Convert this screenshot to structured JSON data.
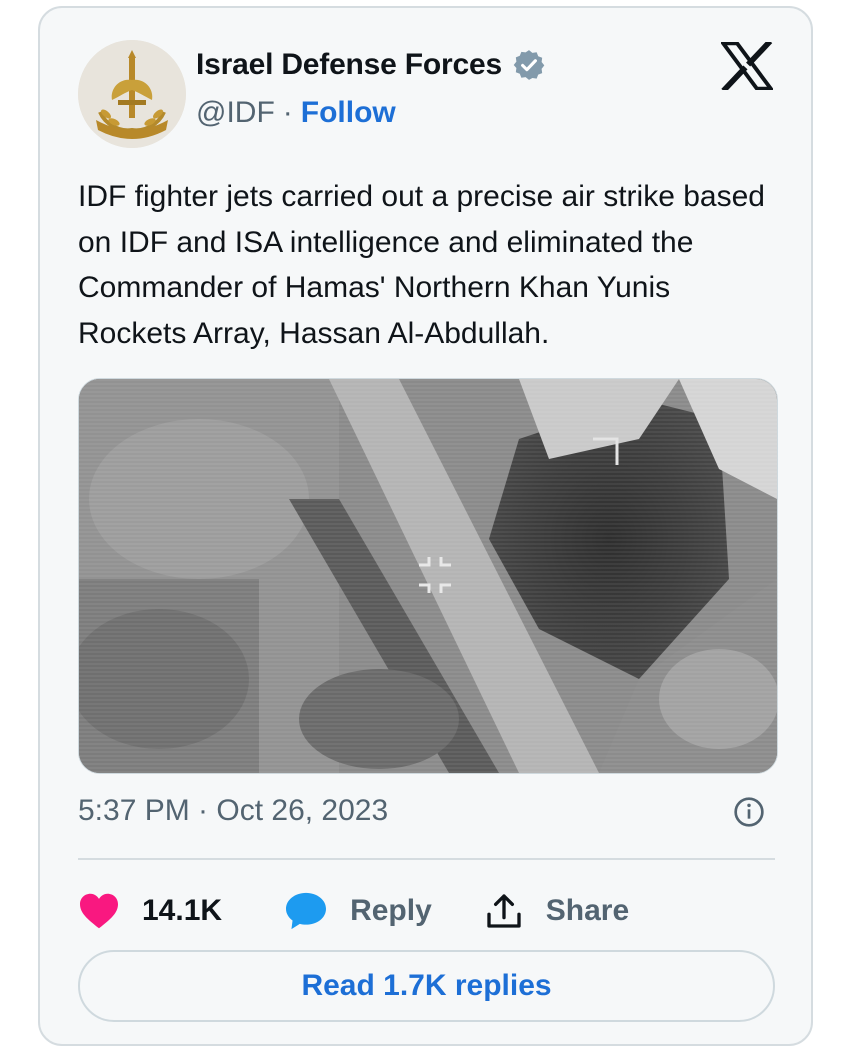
{
  "author": {
    "display_name": "Israel Defense Forces",
    "handle": "@IDF",
    "separator": "·",
    "follow_label": "Follow",
    "avatar_icon": "idf-emblem-icon",
    "verified_icon": "verified-badge-icon",
    "verified_color": "#829aab"
  },
  "brand": {
    "logo_icon": "x-logo-icon"
  },
  "tweet": {
    "text": "IDF fighter jets carried out a precise air strike based on IDF and ISA intelligence and eliminated the Commander of Hamas' Northern Khan Yunis Rockets Array, Hassan Al-Abdullah.",
    "media_description_icon": "aerial-strike-footage",
    "timestamp": "5:37 PM · Oct 26, 2023"
  },
  "actions": {
    "like_count": "14.1K",
    "like_icon": "heart-icon",
    "like_color": "#f91880",
    "reply_label": "Reply",
    "reply_icon": "speech-bubble-icon",
    "reply_color": "#1d9bf0",
    "share_label": "Share",
    "share_icon": "share-upload-icon"
  },
  "footer": {
    "read_replies_label": "Read 1.7K replies",
    "info_icon": "info-icon"
  },
  "colors": {
    "link_blue": "#1d6fd6",
    "secondary_text": "#536471",
    "card_background": "#f6f8f9",
    "border": "#d5dce0"
  }
}
